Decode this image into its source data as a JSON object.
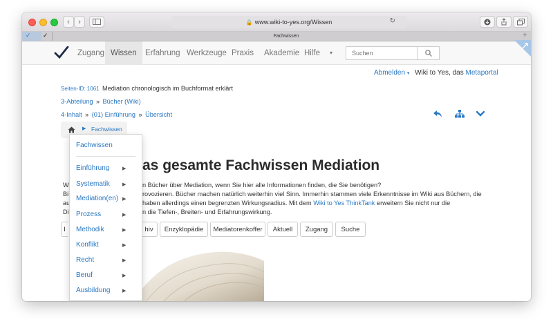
{
  "browser": {
    "url": "www.wiki-to-yes.org/Wissen",
    "tab_title": "Fachwissen"
  },
  "navbar": {
    "items": [
      "Zugang",
      "Wissen",
      "Erfahrung",
      "Werkzeuge",
      "Praxis",
      "Akademie",
      "Hilfe"
    ],
    "search_placeholder": "Suchen"
  },
  "user_bar": {
    "logout": "Abmelden",
    "site_prefix": "Wiki to Yes, das",
    "metaportal": "Metaportal"
  },
  "page_info": {
    "id_label": "Seiten-ID: 1061",
    "subtitle": "Mediation chronologisch im Buchformat erklärt",
    "crumb1_level": "3-Abteilung",
    "crumb1_link": "Bücher (Wiki)",
    "crumb2_level": "4-Inhalt",
    "crumb2_link1": "(01) Einführung",
    "crumb2_link2": "Übersicht",
    "sep": "»"
  },
  "breadcrumb": {
    "current": "Fachwissen"
  },
  "heading": "as gesamte Fachwissen Mediation",
  "intro": {
    "line1a": "Wa",
    "line1b": "n Bücher über Mediation, wenn Sie hier alle Informationen finden, die Sie benötigen?",
    "line2a": "Bi",
    "line2b": "rovozieren. Bücher machen natürlich weiterhin viel Sinn. Immerhin stammen viele Erkenntnisse im Wiki aus Büchern, die",
    "line3a": "au",
    "line3b_pre": "haben allerdings einen begrenzten Wirkungsradius. Mit dem",
    "line3b_link": "Wiki to Yes ThinkTank",
    "line3b_post": "erweitern Sie nicht nur die",
    "line4a": "Di",
    "line4b": "n die Tiefen-, Breiten- und Erfahrungswirkung."
  },
  "buttons": [
    "I",
    "hiv",
    "Enzyklopädie",
    "Mediatorenkoffer",
    "Aktuell",
    "Zugang",
    "Suche"
  ],
  "dropdown": {
    "header": "Fachwissen",
    "items": [
      "Einführung",
      "Systematik",
      "Mediation(en)",
      "Prozess",
      "Methodik",
      "Konflikt",
      "Recht",
      "Beruf",
      "Ausbildung"
    ]
  },
  "colors": {
    "link": "#2a78c2",
    "navbar_bg": "#f8f8f8"
  }
}
